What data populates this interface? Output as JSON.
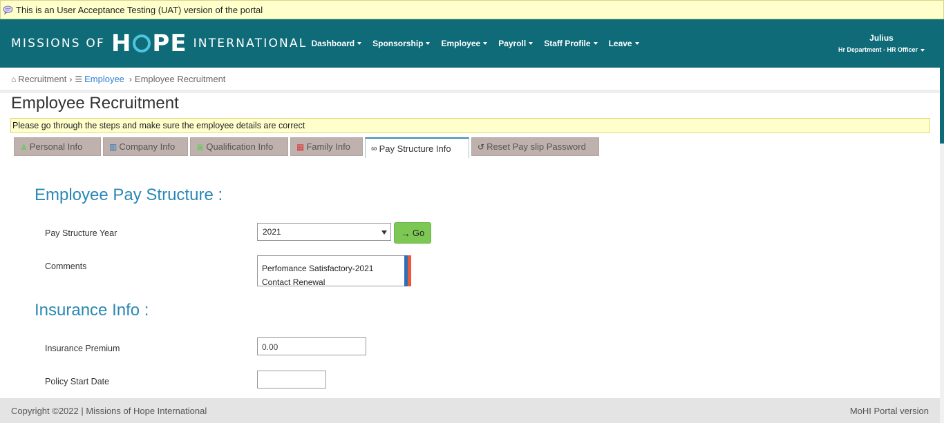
{
  "uat_banner": "This is an User Acceptance Testing (UAT) version of the portal",
  "brand": {
    "left": "MISSIONS OF",
    "big_h": "H",
    "big_pe": "PE",
    "right": "INTERNATIONAL"
  },
  "nav": [
    "Dashboard",
    "Sponsorship",
    "Employee",
    "Payroll",
    "Staff Profile",
    "Leave"
  ],
  "user": {
    "name": "Julius",
    "role": "Hr Department - HR Officer"
  },
  "breadcrumb": {
    "recruitment": "Recruitment",
    "employee": "Employee",
    "current": "Employee Recruitment"
  },
  "page_title": "Employee Recruitment",
  "notice": "Please go through the steps and make sure the employee details are correct",
  "tabs": [
    {
      "label": "Personal Info",
      "icon": "person-icon"
    },
    {
      "label": "Company Info",
      "icon": "building-icon"
    },
    {
      "label": "Qualification Info",
      "icon": "certificate-icon"
    },
    {
      "label": "Family Info",
      "icon": "family-icon"
    },
    {
      "label": "Pay Structure Info",
      "icon": "link-icon"
    },
    {
      "label": "Reset Pay slip Password",
      "icon": "reset-icon"
    }
  ],
  "active_tab": "Pay Structure Info",
  "pay_structure": {
    "title": "Employee Pay Structure :",
    "year_label": "Pay Structure Year",
    "year_value": "2021",
    "go_label": "Go",
    "comments_label": "Comments",
    "comments_line1": "Perfomance Satisfactory-2021",
    "comments_line2": "Contact Renewal"
  },
  "insurance": {
    "title": "Insurance Info :",
    "premium_label": "Insurance Premium",
    "premium_value": "0.00",
    "policy_start_label": "Policy Start Date",
    "policy_start_value": ""
  },
  "footer": {
    "copyright": "Copyright ©2022 | Missions of Hope International",
    "version": "MoHI Portal version"
  },
  "colors": {
    "navbar": "#0f6b78",
    "accent_blue": "#2a88b5",
    "go_green": "#7dc855",
    "tab_inactive": "#bfb1ad",
    "notice_bg": "#ffffcc"
  }
}
